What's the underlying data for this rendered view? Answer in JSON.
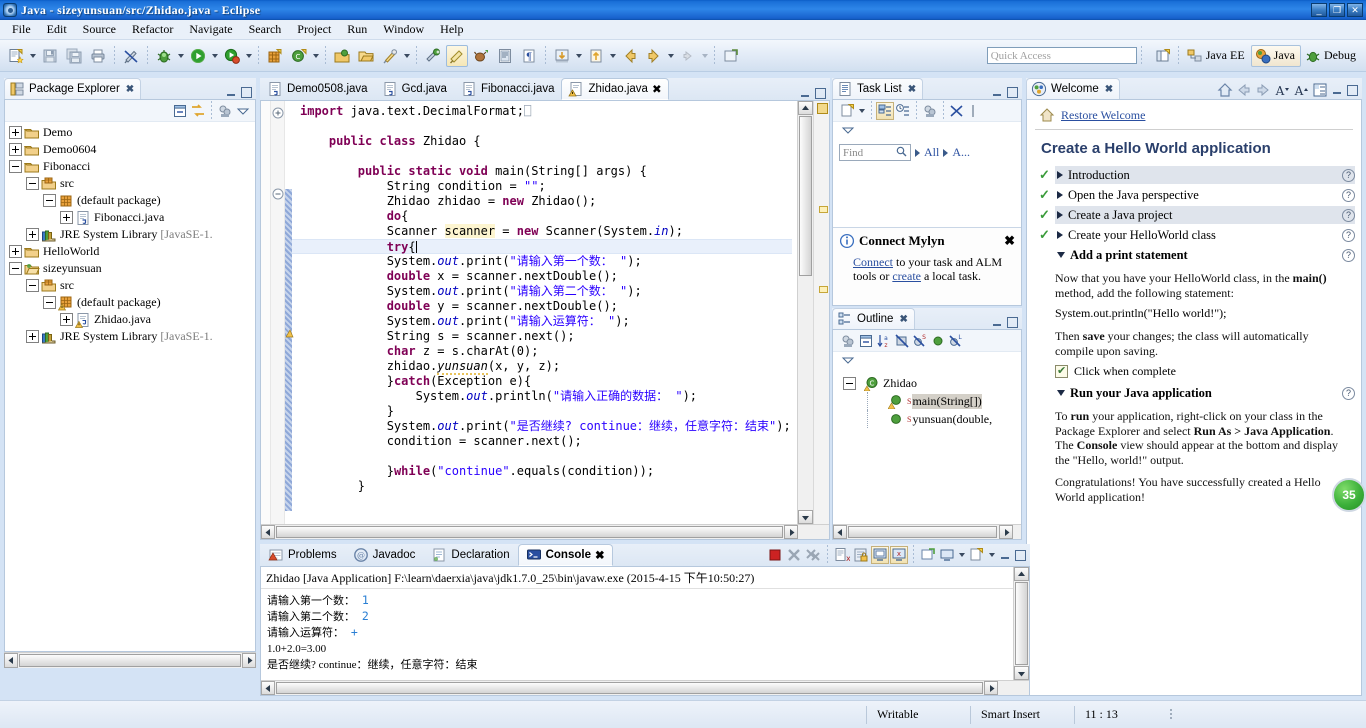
{
  "window": {
    "title": "Java - sizeyunsuan/src/Zhidao.java - Eclipse",
    "app_icon": "eclipse-icon",
    "buttons": {
      "minimize": "_",
      "restore": "❐",
      "close": "✕"
    }
  },
  "menubar": [
    "File",
    "Edit",
    "Source",
    "Refactor",
    "Navigate",
    "Search",
    "Project",
    "Run",
    "Window",
    "Help"
  ],
  "toolbar": {
    "quick_access_placeholder": "Quick Access",
    "perspectives": [
      {
        "label": "Java EE",
        "icon": "java-ee-perspective-icon",
        "selected": false
      },
      {
        "label": "Java",
        "icon": "java-perspective-icon",
        "selected": true
      },
      {
        "label": "Debug",
        "icon": "debug-perspective-icon",
        "selected": false
      }
    ],
    "new_perspective_icon": "open-perspective-icon",
    "items": [
      "new-wizard-icon",
      "save-icon",
      "save-all-icon",
      "print-icon",
      "toggle-mark-occurrences-icon",
      "debug-icon",
      "run-icon",
      "run-coverage-icon",
      "new-java-project-icon",
      "new-java-class-icon",
      "open-type-icon",
      "open-task-icon",
      "search-icon",
      "toggle-ref-icon",
      "toggle-link-icon",
      "external-tools-icon",
      "skip-breakpoints-icon",
      "show-whitespace-icon",
      "next-annotation-icon",
      "previous-annotation-icon",
      "back-icon",
      "forward-icon",
      "pin-editor-icon"
    ]
  },
  "package_explorer": {
    "title": "Package Explorer",
    "icon": "package-explorer-icon",
    "tools": [
      "collapse-all-icon",
      "link-with-editor-icon",
      "focus-active-task-icon",
      "view-menu-icon"
    ],
    "tree": [
      {
        "label": "Demo",
        "icon": "project-closed-icon",
        "indent": 0,
        "state": "collapsed"
      },
      {
        "label": "Demo0604",
        "icon": "project-closed-icon",
        "indent": 0,
        "state": "collapsed"
      },
      {
        "label": "Fibonacci",
        "icon": "project-closed-icon",
        "indent": 0,
        "state": "expanded"
      },
      {
        "label": "src",
        "icon": "source-folder-icon",
        "indent": 1,
        "state": "expanded"
      },
      {
        "label": "(default package)",
        "icon": "package-icon",
        "indent": 2,
        "state": "expanded"
      },
      {
        "label": "Fibonacci.java",
        "icon": "java-file-icon",
        "indent": 3,
        "state": "collapsed"
      },
      {
        "label": "JRE System Library",
        "suffix": "[JavaSE-1.",
        "icon": "jre-library-icon",
        "indent": 1,
        "state": "collapsed"
      },
      {
        "label": "HelloWorld",
        "icon": "project-closed-icon",
        "indent": 0,
        "state": "collapsed"
      },
      {
        "label": "sizeyunsuan",
        "icon": "project-open-icon",
        "indent": 0,
        "state": "expanded"
      },
      {
        "label": "src",
        "icon": "source-folder-icon",
        "indent": 1,
        "state": "expanded"
      },
      {
        "label": "(default package)",
        "icon": "package-warning-icon",
        "indent": 2,
        "state": "expanded"
      },
      {
        "label": "Zhidao.java",
        "icon": "java-file-warning-icon",
        "indent": 3,
        "state": "collapsed"
      },
      {
        "label": "JRE System Library",
        "suffix": "[JavaSE-1.",
        "icon": "jre-library-icon",
        "indent": 1,
        "state": "collapsed"
      }
    ]
  },
  "editor": {
    "tabs": [
      {
        "label": "Demo0508.java",
        "icon": "java-file-icon",
        "selected": false
      },
      {
        "label": "Gcd.java",
        "icon": "java-file-icon",
        "selected": false
      },
      {
        "label": "Fibonacci.java",
        "icon": "java-file-icon",
        "selected": false
      },
      {
        "label": "Zhidao.java",
        "icon": "java-file-warning-icon",
        "selected": true
      }
    ],
    "code_lines": [
      {
        "indent": 0,
        "marker": "import-collapse",
        "tokens": [
          {
            "t": "import ",
            "c": "kw"
          },
          {
            "t": "java.text.DecimalFormat;",
            "c": ""
          },
          {
            "t": "⎕",
            "c": "dim"
          }
        ]
      },
      {
        "indent": 0,
        "tokens": []
      },
      {
        "indent": 1,
        "tokens": [
          {
            "t": "public ",
            "c": "kw"
          },
          {
            "t": "class ",
            "c": "kw"
          },
          {
            "t": "Zhidao {",
            "c": ""
          }
        ]
      },
      {
        "indent": 1,
        "tokens": []
      },
      {
        "indent": 2,
        "marker": "fold",
        "tokens": [
          {
            "t": "public static void ",
            "c": "kw"
          },
          {
            "t": "main(String[] args) {",
            "c": ""
          }
        ]
      },
      {
        "indent": 3,
        "tokens": [
          {
            "t": "String condition = ",
            "c": ""
          },
          {
            "t": "\"\"",
            "c": "str"
          },
          {
            "t": ";",
            "c": ""
          }
        ]
      },
      {
        "indent": 3,
        "tokens": [
          {
            "t": "Zhidao zhidao = ",
            "c": ""
          },
          {
            "t": "new ",
            "c": "kw"
          },
          {
            "t": "Zhidao();",
            "c": ""
          }
        ]
      },
      {
        "indent": 3,
        "tokens": [
          {
            "t": "do",
            "c": "kw"
          },
          {
            "t": "{",
            "c": ""
          }
        ]
      },
      {
        "indent": 3,
        "tokens": [
          {
            "t": "Scanner ",
            "c": ""
          },
          {
            "t": "scanner",
            "c": "occ"
          },
          {
            "t": " = ",
            "c": ""
          },
          {
            "t": "new ",
            "c": "kw"
          },
          {
            "t": "Scanner(System.",
            "c": ""
          },
          {
            "t": "in",
            "c": "fld"
          },
          {
            "t": ");",
            "c": ""
          }
        ]
      },
      {
        "indent": 3,
        "highlight": true,
        "cursor": true,
        "tokens": [
          {
            "t": "try",
            "c": "kw"
          },
          {
            "t": "{",
            "c": ""
          }
        ]
      },
      {
        "indent": 3,
        "tokens": [
          {
            "t": "System.",
            "c": ""
          },
          {
            "t": "out",
            "c": "fld"
          },
          {
            "t": ".print(",
            "c": ""
          },
          {
            "t": "\"请输入第一个数： \"",
            "c": "str"
          },
          {
            "t": ");",
            "c": ""
          }
        ]
      },
      {
        "indent": 3,
        "tokens": [
          {
            "t": "double ",
            "c": "kw"
          },
          {
            "t": "x = scanner.nextDouble();",
            "c": ""
          }
        ]
      },
      {
        "indent": 3,
        "tokens": [
          {
            "t": "System.",
            "c": ""
          },
          {
            "t": "out",
            "c": "fld"
          },
          {
            "t": ".print(",
            "c": ""
          },
          {
            "t": "\"请输入第二个数： \"",
            "c": "str"
          },
          {
            "t": ");",
            "c": ""
          }
        ]
      },
      {
        "indent": 3,
        "tokens": [
          {
            "t": "double ",
            "c": "kw"
          },
          {
            "t": "y = scanner.nextDouble();",
            "c": ""
          }
        ]
      },
      {
        "indent": 3,
        "tokens": [
          {
            "t": "System.",
            "c": ""
          },
          {
            "t": "out",
            "c": "fld"
          },
          {
            "t": ".print(",
            "c": ""
          },
          {
            "t": "\"请输入运算符： \"",
            "c": "str"
          },
          {
            "t": ");",
            "c": ""
          }
        ]
      },
      {
        "indent": 3,
        "tokens": [
          {
            "t": "String s = scanner.next();",
            "c": ""
          }
        ]
      },
      {
        "indent": 3,
        "tokens": [
          {
            "t": "char ",
            "c": "kw"
          },
          {
            "t": "z = s.charAt(0);",
            "c": ""
          }
        ]
      },
      {
        "indent": 3,
        "tokens": [
          {
            "t": "zhidao.",
            "c": ""
          },
          {
            "t": "yunsuan",
            "c": "stat"
          },
          {
            "t": "(x, y, z);",
            "c": ""
          }
        ]
      },
      {
        "indent": 3,
        "tokens": [
          {
            "t": "}",
            "c": ""
          },
          {
            "t": "catch",
            "c": "kw"
          },
          {
            "t": "(Exception e){",
            "c": ""
          }
        ]
      },
      {
        "indent": 4,
        "tokens": [
          {
            "t": "System.",
            "c": ""
          },
          {
            "t": "out",
            "c": "fld"
          },
          {
            "t": ".println(",
            "c": ""
          },
          {
            "t": "\"请输入正确的数据： \"",
            "c": "str"
          },
          {
            "t": ");",
            "c": ""
          }
        ]
      },
      {
        "indent": 3,
        "tokens": [
          {
            "t": "}",
            "c": ""
          }
        ]
      },
      {
        "indent": 3,
        "tokens": [
          {
            "t": "System.",
            "c": ""
          },
          {
            "t": "out",
            "c": "fld"
          },
          {
            "t": ".print(",
            "c": ""
          },
          {
            "t": "\"是否继续? continue：继续，任意字符：结束\"",
            "c": "str"
          },
          {
            "t": ");",
            "c": ""
          }
        ]
      },
      {
        "indent": 3,
        "tokens": [
          {
            "t": "condition = scanner.next();",
            "c": ""
          }
        ]
      },
      {
        "indent": 3,
        "tokens": []
      },
      {
        "indent": 3,
        "tokens": [
          {
            "t": "}",
            "c": ""
          },
          {
            "t": "while",
            "c": "kw"
          },
          {
            "t": "(",
            "c": ""
          },
          {
            "t": "\"continue\"",
            "c": "str"
          },
          {
            "t": ".equals(condition));",
            "c": ""
          }
        ]
      },
      {
        "indent": 2,
        "tokens": [
          {
            "t": "}",
            "c": ""
          }
        ]
      }
    ]
  },
  "task_list": {
    "title": "Task List",
    "icon": "task-list-icon",
    "tools": [
      "new-task-icon",
      "categorize-icon",
      "schedule-icon",
      "focus-icon",
      "collapse-all-icon",
      "view-menu-icon"
    ],
    "find_placeholder": "Find",
    "filters": [
      "All",
      "A..."
    ],
    "notification": {
      "title": "Connect Mylyn",
      "icon": "info-icon",
      "text_parts": [
        "Connect",
        " to your task and ALM tools or ",
        "create",
        " a local task."
      ]
    }
  },
  "outline": {
    "title": "Outline",
    "icon": "outline-icon",
    "tools": [
      "focus-icon",
      "collapse-all-icon",
      "sort-icon",
      "hide-fields-icon",
      "hide-static-icon",
      "hide-nonpublic-icon",
      "hide-local-icon",
      "view-menu-icon"
    ],
    "tree": [
      {
        "label": "Zhidao",
        "icon": "class-icon",
        "indent": 0,
        "state": "expanded",
        "selected": false
      },
      {
        "label": "main(String[])",
        "icon": "method-public-static-warning-icon",
        "indent": 1,
        "state": "leaf",
        "selected": true,
        "badge": "S"
      },
      {
        "label": "yunsuan(double,",
        "icon": "method-public-icon",
        "indent": 1,
        "state": "leaf",
        "selected": false,
        "badge": "S"
      }
    ]
  },
  "welcome": {
    "title": "Welcome",
    "icon": "welcome-icon",
    "tools": [
      "home-icon",
      "back-icon",
      "forward-icon",
      "decrease-font-icon",
      "increase-font-icon",
      "toggle-toc-icon"
    ],
    "restore_link": "Restore Welcome",
    "heading": "Create a Hello World application",
    "steps": [
      {
        "label": "Introduction",
        "done": true,
        "expanded": false,
        "shaded": true
      },
      {
        "label": "Open the Java perspective",
        "done": true,
        "expanded": false,
        "shaded": false
      },
      {
        "label": "Create a Java project",
        "done": true,
        "expanded": false,
        "shaded": true
      },
      {
        "label": "Create your HelloWorld class",
        "done": true,
        "expanded": false,
        "shaded": false
      },
      {
        "label": "Add a print statement",
        "done": false,
        "expanded": true,
        "shaded": false
      }
    ],
    "print_step": {
      "paragraph_1": "Now that you have your HelloWorld class, in the main() method, add the following statement:",
      "code": "System.out.println(\"Hello world!\");",
      "paragraph_2": "Then save your changes; the class will automatically compile upon saving.",
      "checkbox_label": "Click when complete"
    },
    "run_step": {
      "label": "Run your Java application",
      "expanded": true,
      "paragraph_1": "To run your application, right-click on your class in the Package Explorer and select Run As > Java Application. The Console view should appear at the bottom and display the \"Hello, world!\" output.",
      "paragraph_2": "Congratulations! You have successfully created a Hello World application!"
    },
    "badge": "35"
  },
  "console": {
    "tabs": [
      {
        "label": "Problems",
        "icon": "problems-icon",
        "selected": false
      },
      {
        "label": "Javadoc",
        "icon": "javadoc-icon",
        "selected": false
      },
      {
        "label": "Declaration",
        "icon": "declaration-icon",
        "selected": false
      },
      {
        "label": "Console",
        "icon": "console-icon",
        "selected": true
      }
    ],
    "tools": [
      "terminate-icon",
      "remove-launch-icon",
      "remove-all-terminated-icon",
      "clear-console-icon",
      "scroll-lock-icon",
      "pin-console-icon",
      "display-selected-console-icon",
      "open-console-icon",
      "new-console-view-icon",
      "minimize-icon",
      "maximize-icon"
    ],
    "launch_line": "Zhidao [Java Application] F:\\learn\\daerxia\\java\\jdk1.7.0_25\\bin\\javaw.exe (2015-4-15 下午10:50:27)",
    "output": [
      {
        "prompt": "请输入第一个数：",
        "input": "1"
      },
      {
        "prompt": "请输入第二个数：",
        "input": "2"
      },
      {
        "prompt": "请输入运算符：",
        "input": "+"
      },
      {
        "prompt": "1.0+2.0=3.00",
        "input": ""
      },
      {
        "prompt": "是否继续? continue：继续，任意字符：结束",
        "input": ""
      }
    ]
  },
  "statusbar": {
    "writable": "Writable",
    "insert_mode": "Smart Insert",
    "position": "11 : 13"
  },
  "colors": {
    "title_blue": "#1a6fd8",
    "keyword": "#7f0055",
    "string": "#2a00ff",
    "field": "#0000c0",
    "accent": "#2a4fa0",
    "badge_green": "#3cb03a"
  }
}
